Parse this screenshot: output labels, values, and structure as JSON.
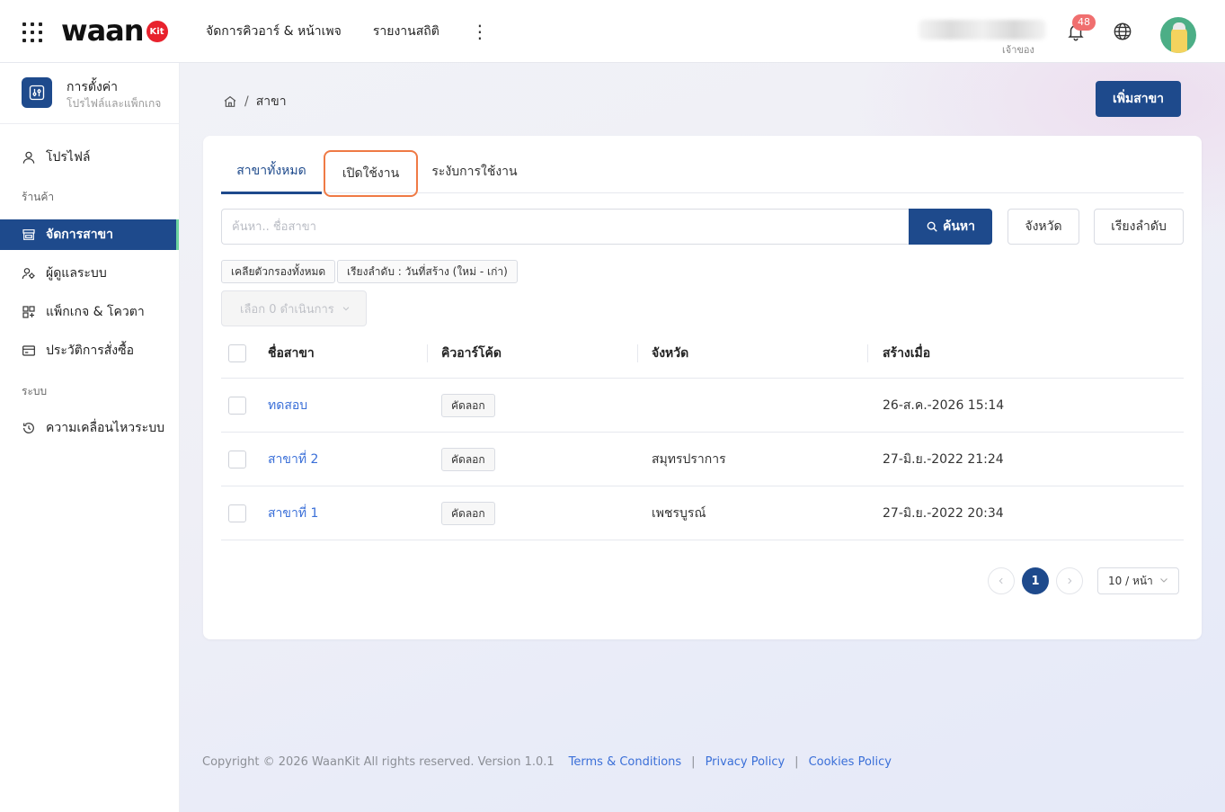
{
  "header": {
    "logo_text": "waan",
    "logo_badge": "Kit",
    "nav": [
      {
        "label": "จัดการคิวอาร์ & หน้าเพจ"
      },
      {
        "label": "รายงานสถิติ"
      }
    ],
    "more_label": "⋮",
    "shop_role": "เจ้าของ",
    "notification_count": "48"
  },
  "sidebar": {
    "title": "การตั้งค่า",
    "subtitle": "โปรไฟล์และแพ็กเกจ",
    "profile_label": "โปรไฟล์",
    "section_store": "ร้านค้า",
    "items_store": [
      {
        "label": "จัดการสาขา",
        "icon": "store-icon",
        "active": true
      },
      {
        "label": "ผู้ดูแลระบบ",
        "icon": "users-icon"
      },
      {
        "label": "แพ็กเกจ & โควตา",
        "icon": "package-icon"
      },
      {
        "label": "ประวัติการสั่งซื้อ",
        "icon": "card-icon"
      }
    ],
    "section_system": "ระบบ",
    "items_system": [
      {
        "label": "ความเคลื่อนไหวระบบ",
        "icon": "history-icon"
      }
    ]
  },
  "page": {
    "breadcrumb_current": "สาขา",
    "add_button": "เพิ่มสาขา",
    "tabs": [
      {
        "label": "สาขาทั้งหมด",
        "active": true
      },
      {
        "label": "เปิดใช้งาน",
        "highlighted": true
      },
      {
        "label": "ระงับการใช้งาน"
      }
    ],
    "search": {
      "placeholder": "ค้นหา.. ชื่อสาขา",
      "value": "",
      "button": "ค้นหา"
    },
    "filter_province": "จังหวัด",
    "sort_button": "เรียงลำดับ",
    "chips": {
      "clear_all": "เคลียตัวกรองทั้งหมด",
      "sort": "เรียงลำดับ : วันที่สร้าง (ใหม่ - เก่า)"
    },
    "bulk_action": "เลือก 0 ดำเนินการ",
    "table": {
      "columns": [
        "ชื่อสาขา",
        "คิวอาร์โค้ด",
        "จังหวัด",
        "สร้างเมื่อ"
      ],
      "rows": [
        {
          "name": "ทดสอบ",
          "qr": "คัดลอก",
          "province": "",
          "created": "26-ส.ค.-2026 15:14"
        },
        {
          "name": "สาขาที่ 2",
          "qr": "คัดลอก",
          "province": "สมุทรปราการ",
          "created": "27-มิ.ย.-2022 21:24"
        },
        {
          "name": "สาขาที่ 1",
          "qr": "คัดลอก",
          "province": "เพชรบูรณ์",
          "created": "27-มิ.ย.-2022 20:34"
        }
      ]
    },
    "pagination": {
      "current_page": "1",
      "page_size": "10 / หน้า"
    }
  },
  "footer": {
    "copyright": "Copyright © 2026 WaanKit All rights reserved. Version 1.0.1",
    "links": [
      "Terms & Conditions",
      "Privacy Policy",
      "Cookies Policy"
    ],
    "separator": "|"
  },
  "colors": {
    "primary": "#1e4a8c",
    "link": "#3a6fd8",
    "badge": "#f06f6f",
    "tab_highlight": "#ef7a45",
    "active_indicator": "#6dd4a0"
  }
}
